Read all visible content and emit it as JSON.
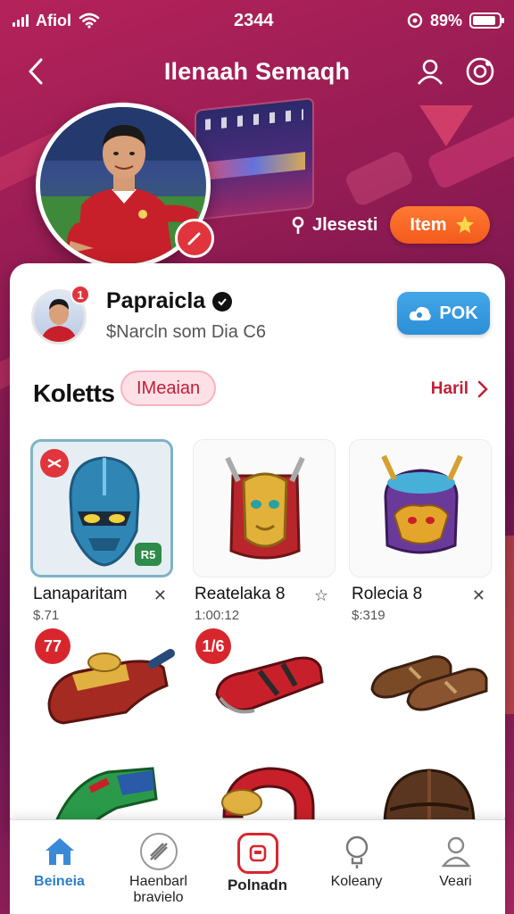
{
  "status_bar": {
    "carrier": "Afiol",
    "time": "2344",
    "battery": "89%",
    "battery_level": 0.89,
    "icons": [
      "signal-icon",
      "wifi-icon",
      "alarm-icon",
      "battery-icon"
    ]
  },
  "header": {
    "title": "Ilenaah Semaqh",
    "icons": [
      "back-icon",
      "user-icon",
      "settings-icon"
    ]
  },
  "hero": {
    "location_label": "Jlesesti",
    "item_button_label": "Item",
    "item_button_icon": "star-icon"
  },
  "profile": {
    "name": "Papraicla",
    "subtitle": "$Narcln som Dia C6",
    "notification_count": "1",
    "action_button_label": "POK",
    "action_button_icon": "cloud-icon"
  },
  "collection": {
    "title": "Koletts",
    "filter_pill": "IMeaian",
    "see_all": "Haril",
    "items": [
      {
        "name": "Lanaparitam",
        "price": "$.71",
        "fav_icon": "x-mark-icon"
      },
      {
        "name": "Reatelaka 8",
        "price": "1:00:12",
        "fav_icon": "star-outline-icon"
      },
      {
        "name": "Rolecia 8",
        "price": "$:319",
        "fav_icon": "x-mark-icon"
      }
    ],
    "first_tile_badge": "R5",
    "row2_badges": [
      "77",
      "1/6"
    ]
  },
  "tabbar": {
    "tabs": [
      {
        "label": "Beineia",
        "icon": "home-icon"
      },
      {
        "label": "Haenbarl\nbravielo",
        "icon": "slash-circle-icon"
      },
      {
        "label": "Polnadn",
        "icon": "store-icon"
      },
      {
        "label": "Koleany",
        "icon": "lightbulb-icon"
      },
      {
        "label": "Veari",
        "icon": "profile-icon"
      }
    ]
  },
  "colors": {
    "background": "#8e1b4e",
    "accent_orange": "#f25a1c",
    "accent_blue": "#2c8fd7",
    "accent_red": "#d8262e",
    "tab_active": "#2c7fc8"
  }
}
